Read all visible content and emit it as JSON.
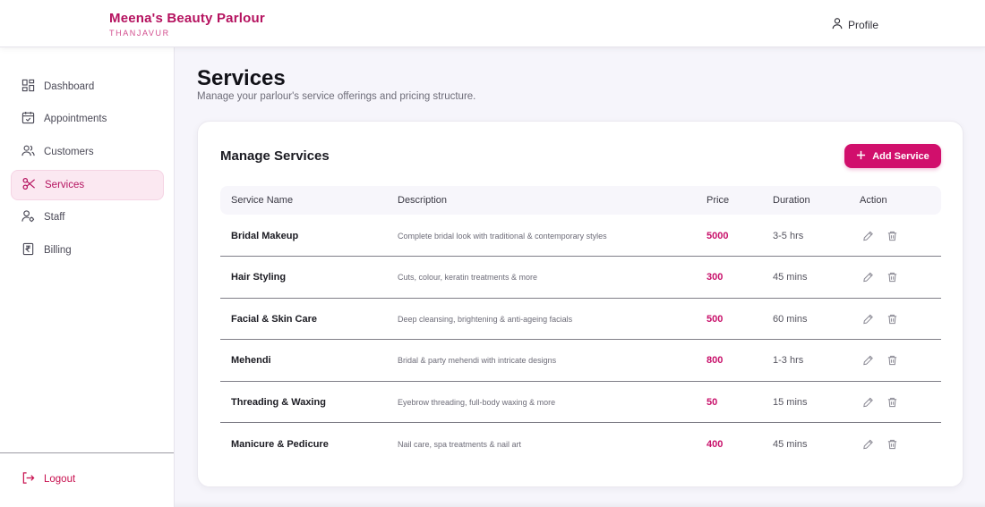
{
  "header": {
    "brand_name": "Meena's Beauty Parlour",
    "brand_city": "THANJAVUR",
    "profile_label": "Profile"
  },
  "sidebar": {
    "items": [
      {
        "label": "Dashboard",
        "icon": "dashboard-grid-icon"
      },
      {
        "label": "Appointments",
        "icon": "calendar-icon"
      },
      {
        "label": "Customers",
        "icon": "users-icon"
      },
      {
        "label": "Services",
        "icon": "scissors-icon",
        "active": true
      },
      {
        "label": "Staff",
        "icon": "staff-icon"
      },
      {
        "label": "Billing",
        "icon": "receipt-icon"
      }
    ],
    "logout_label": "Logout"
  },
  "page": {
    "title": "Services",
    "subtitle": "Manage your parlour's service offerings and pricing structure."
  },
  "card": {
    "title": "Manage Services",
    "add_button_label": "Add Service",
    "columns": [
      "Service Name",
      "Description",
      "Price",
      "Duration",
      "Action"
    ],
    "rows": [
      {
        "name": "Bridal Makeup",
        "description": "Complete bridal look with traditional & contemporary styles",
        "price": "5000",
        "duration": "3-5 hrs"
      },
      {
        "name": "Hair Styling",
        "description": "Cuts, colour, keratin treatments & more",
        "price": "300",
        "duration": "45 mins"
      },
      {
        "name": "Facial & Skin Care",
        "description": "Deep cleansing, brightening & anti-ageing facials",
        "price": "500",
        "duration": "60 mins"
      },
      {
        "name": "Mehendi",
        "description": "Bridal & party mehendi with intricate designs",
        "price": "800",
        "duration": "1-3 hrs"
      },
      {
        "name": "Threading & Waxing",
        "description": "Eyebrow threading, full-body waxing & more",
        "price": "50",
        "duration": "15 mins"
      },
      {
        "name": "Manicure & Pedicure",
        "description": "Nail care, spa treatments & nail art",
        "price": "400",
        "duration": "45 mins"
      }
    ]
  },
  "colors": {
    "brand": "#b5125f",
    "accent": "#d10f6c",
    "active_bg": "#fbe8f1",
    "logout": "#c8104f"
  }
}
